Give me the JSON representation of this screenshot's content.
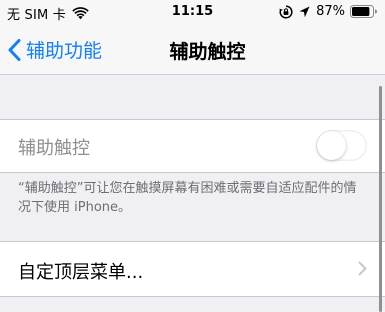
{
  "status_bar": {
    "carrier": "无 SIM 卡",
    "time": "11:15",
    "battery_percent": "87%",
    "battery_level": 0.87,
    "icons": [
      "wifi-icon",
      "orientation-lock-icon",
      "location-icon",
      "battery-icon"
    ]
  },
  "nav": {
    "back_label": "辅助功能",
    "title": "辅助触控"
  },
  "settings": {
    "toggle_row": {
      "label": "辅助触控",
      "enabled": false
    },
    "footer": "“辅助触控”可让您在触摸屏幕有困难或需要自适应配件的情况下使用 iPhone。",
    "menu_row": {
      "label": "自定顶层菜单..."
    }
  },
  "colors": {
    "accent": "#147efb",
    "background": "#efeff4",
    "secondary_text": "#8e8e93"
  }
}
